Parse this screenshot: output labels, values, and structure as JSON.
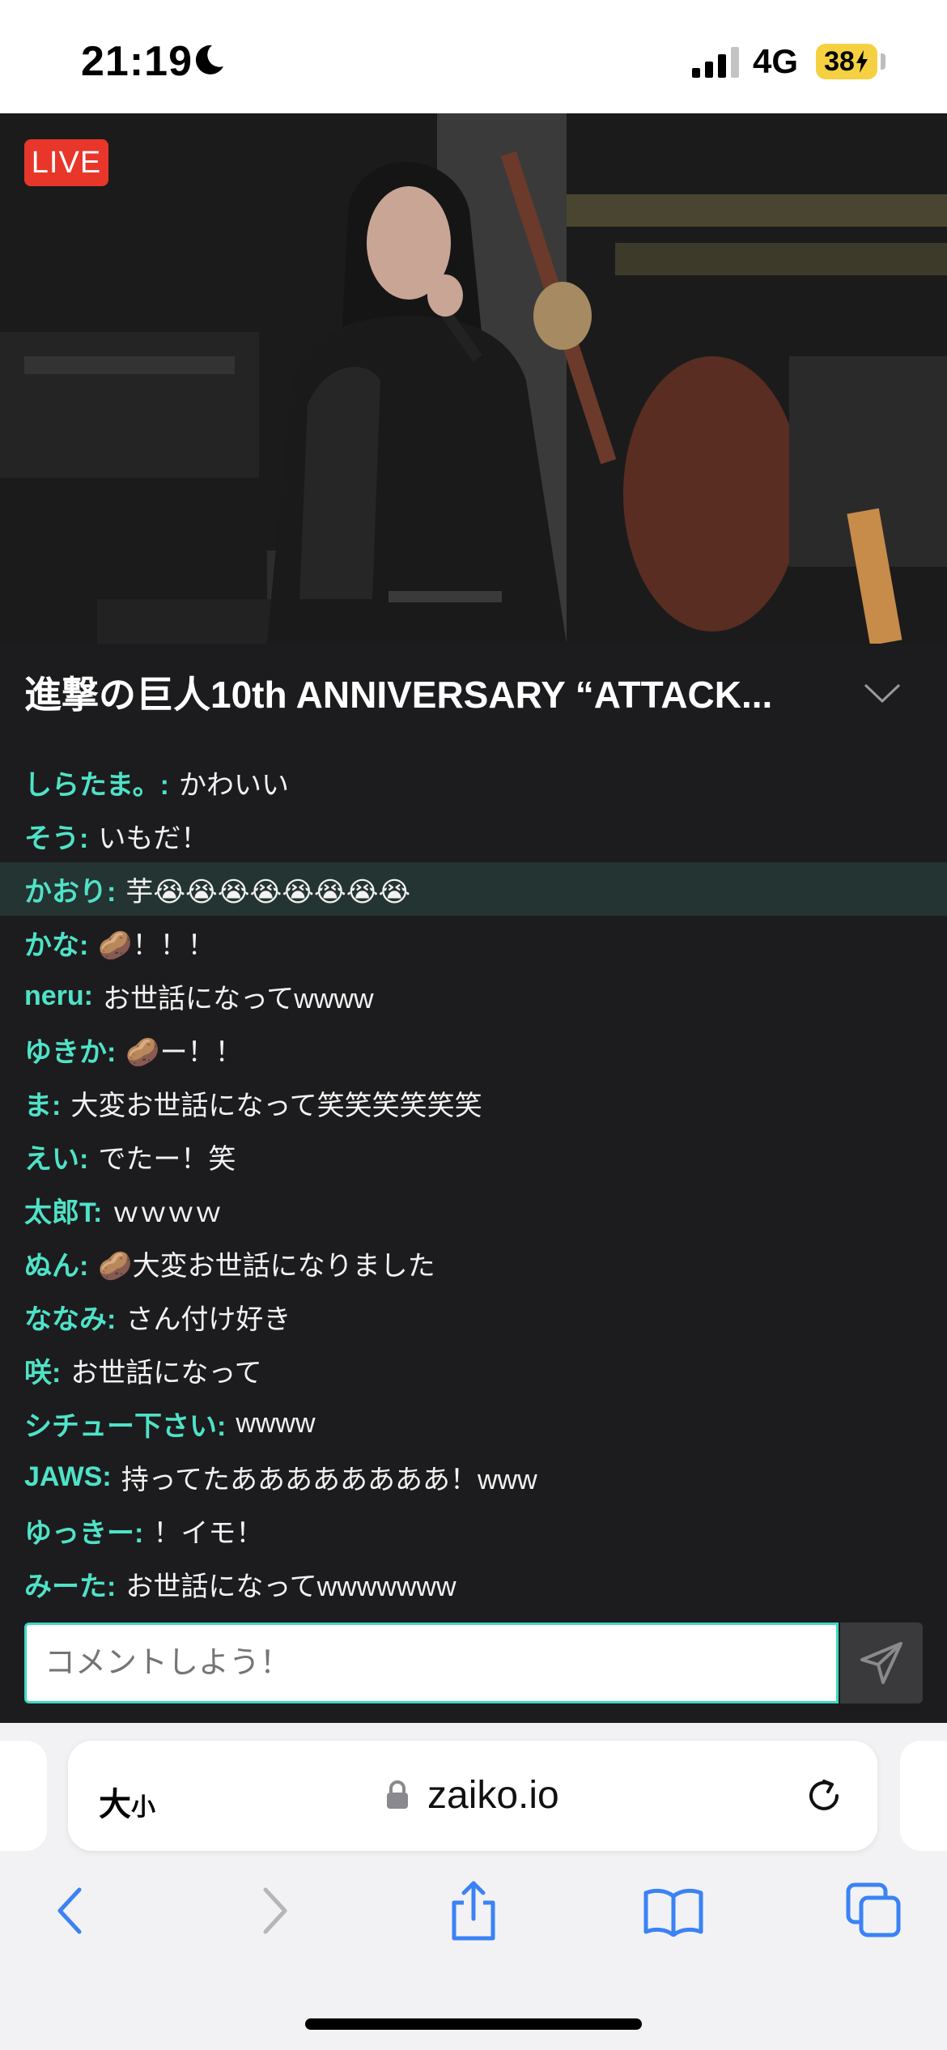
{
  "status_bar": {
    "time": "21:19",
    "network": "4G",
    "battery": "38"
  },
  "video": {
    "live_label": "LIVE"
  },
  "event": {
    "title": "進撃の巨人10th ANNIVERSARY “ATTACK..."
  },
  "chat": {
    "messages": [
      {
        "name": "しらたま。:",
        "text": "かわいい"
      },
      {
        "name": "そう:",
        "text": "いもだ！"
      },
      {
        "name": "かおり:",
        "text": "芋😭😭😭😭😭😭😭😭"
      },
      {
        "name": "かな:",
        "text": "🥔！！！"
      },
      {
        "name": "neru:",
        "text": "お世話になってwwww"
      },
      {
        "name": "ゆきか:",
        "text": "🥔ー！！"
      },
      {
        "name": "ま:",
        "text": "大変お世話になって笑笑笑笑笑笑"
      },
      {
        "name": "えい:",
        "text": "でたー！笑"
      },
      {
        "name": "太郎T:",
        "text": "ｗｗｗｗ"
      },
      {
        "name": "ぬん:",
        "text": "🥔大変お世話になりました"
      },
      {
        "name": "ななみ:",
        "text": "さん付け好き"
      },
      {
        "name": "咲:",
        "text": "お世話になって"
      },
      {
        "name": "シチュー下さい:",
        "text": "wwww"
      },
      {
        "name": "JAWS:",
        "text": "持ってたああああああああ！www"
      },
      {
        "name": "ゆっきー:",
        "text": "！イモ！"
      },
      {
        "name": "みーた:",
        "text": "お世話になってwwwwwww"
      }
    ]
  },
  "comment": {
    "placeholder": "コメントしよう！"
  },
  "browser": {
    "text_size_big": "大",
    "text_size_small": "小",
    "url": "zaiko.io"
  },
  "colors": {
    "accent": "#4fe2c7",
    "live": "#e8362a",
    "highlight_row": "#243432",
    "battery": "#f5d142"
  }
}
